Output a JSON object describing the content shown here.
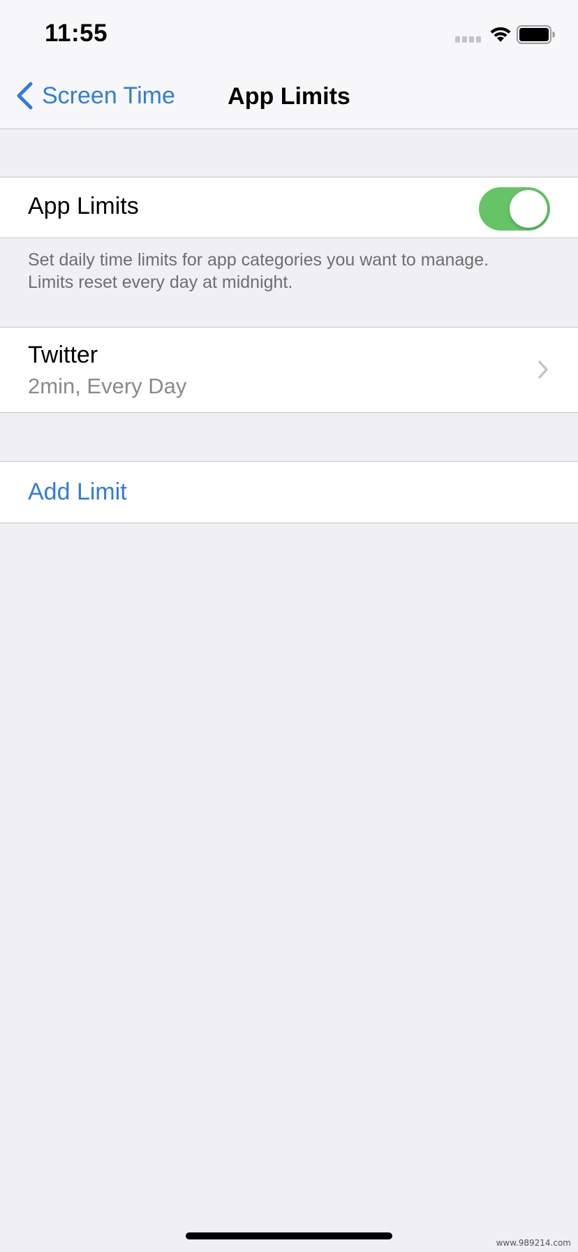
{
  "status_bar": {
    "time": "11:55",
    "signal_icon": "signal-bars-icon",
    "wifi_icon": "wifi-icon",
    "battery_icon": "battery-icon"
  },
  "nav": {
    "back_label": "Screen Time",
    "back_icon": "chevron-left-icon",
    "title": "App Limits"
  },
  "app_limits_toggle": {
    "label": "App Limits",
    "enabled": true
  },
  "footer": {
    "text_line1": "Set daily time limits for app categories you want to manage.",
    "text_line2": "Limits reset every day at midnight."
  },
  "limits": [
    {
      "name": "Twitter",
      "detail": "2min, Every Day",
      "icon": "chevron-right-icon"
    }
  ],
  "add_limit": {
    "label": "Add Limit"
  },
  "watermark": "www.989214.com",
  "colors": {
    "accent": "#2f7cdf",
    "toggle_on": "#65c466",
    "background": "#efeff4",
    "secondary_text": "#8a8a8e"
  }
}
